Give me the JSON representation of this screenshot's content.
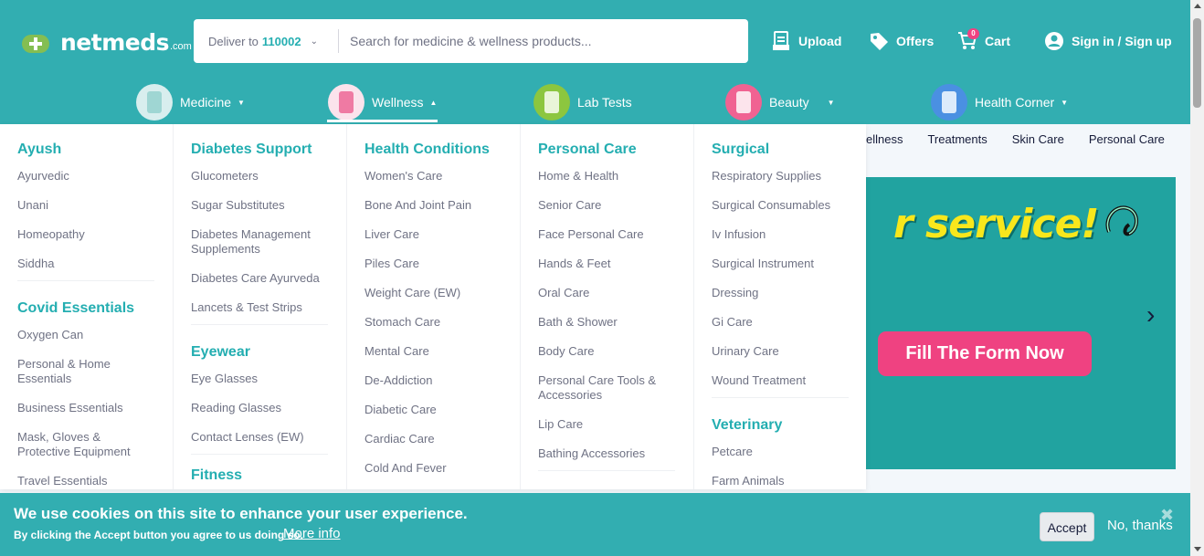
{
  "brand": {
    "name": "netmeds",
    "suffix": ".com"
  },
  "header": {
    "deliver_label": "Deliver to",
    "pincode": "110002",
    "search_placeholder": "Search for medicine & wellness products...",
    "upload": "Upload",
    "offers": "Offers",
    "cart": "Cart",
    "cart_count": "0",
    "signin": "Sign in / Sign up"
  },
  "categories": [
    {
      "label": "Medicine",
      "icon": "medicine-icon"
    },
    {
      "label": "Wellness",
      "icon": "wellness-icon",
      "active": true
    },
    {
      "label": "Lab Tests",
      "icon": "lab-tests-icon"
    },
    {
      "label": "Beauty",
      "icon": "beauty-icon"
    },
    {
      "label": "Health Corner",
      "icon": "health-corner-icon"
    }
  ],
  "mega_menu": {
    "col1": {
      "sections": [
        {
          "title": "Ayush",
          "items": [
            "Ayurvedic",
            "Unani",
            "Homeopathy",
            "Siddha"
          ]
        },
        {
          "title": "Covid Essentials",
          "items": [
            "Oxygen Can",
            "Personal & Home Essentials",
            "Business Essentials",
            "Mask, Gloves & Protective Equipment",
            "Travel Essentials"
          ]
        }
      ]
    },
    "col2": {
      "sections": [
        {
          "title": "Diabetes Support",
          "items": [
            "Glucometers",
            "Sugar Substitutes",
            "Diabetes Management Supplements",
            "Diabetes Care Ayurveda",
            "Lancets & Test Strips"
          ]
        },
        {
          "title": "Eyewear",
          "items": [
            "Eye Glasses",
            "Reading Glasses",
            "Contact Lenses (EW)"
          ]
        },
        {
          "title": "Fitness",
          "items": []
        }
      ]
    },
    "col3": {
      "sections": [
        {
          "title": "Health Conditions",
          "items": [
            "Women's Care",
            "Bone And Joint Pain",
            "Liver Care",
            "Piles Care",
            "Weight Care (EW)",
            "Stomach Care",
            "Mental Care",
            "De-Addiction",
            "Diabetic Care",
            "Cardiac Care",
            "Cold And Fever"
          ]
        }
      ]
    },
    "col4": {
      "sections": [
        {
          "title": "Personal Care",
          "items": [
            "Home & Health",
            "Senior Care",
            "Face Personal Care",
            "Hands & Feet",
            "Oral Care",
            "Bath & Shower",
            "Body Care",
            "Personal Care Tools & Accessories",
            "Lip Care",
            "Bathing Accessories"
          ]
        }
      ]
    },
    "col5": {
      "sections": [
        {
          "title": "Surgical",
          "items": [
            "Respiratory Supplies",
            "Surgical Consumables",
            "Iv Infusion",
            "Surgical Instrument",
            "Dressing",
            "Gi Care",
            "Urinary Care",
            "Wound Treatment"
          ]
        },
        {
          "title": "Veterinary",
          "items": [
            "Petcare",
            "Farm Animals"
          ]
        }
      ]
    }
  },
  "background_page": {
    "tabs": [
      "ellness",
      "Treatments",
      "Skin Care",
      "Personal Care"
    ],
    "banner_text": "r service!",
    "banner_cta": "Fill The Form Now"
  },
  "cookie": {
    "title": "We use cookies on this site to enhance your user experience.",
    "subtitle": "By clicking the Accept button you agree to us doing so.",
    "more_info": "More info",
    "accept": "Accept",
    "no_thanks": "No, thanks"
  },
  "colors": {
    "teal": "#32aeb1",
    "menu_heading": "#24aeb1",
    "pink": "#ef4281"
  }
}
